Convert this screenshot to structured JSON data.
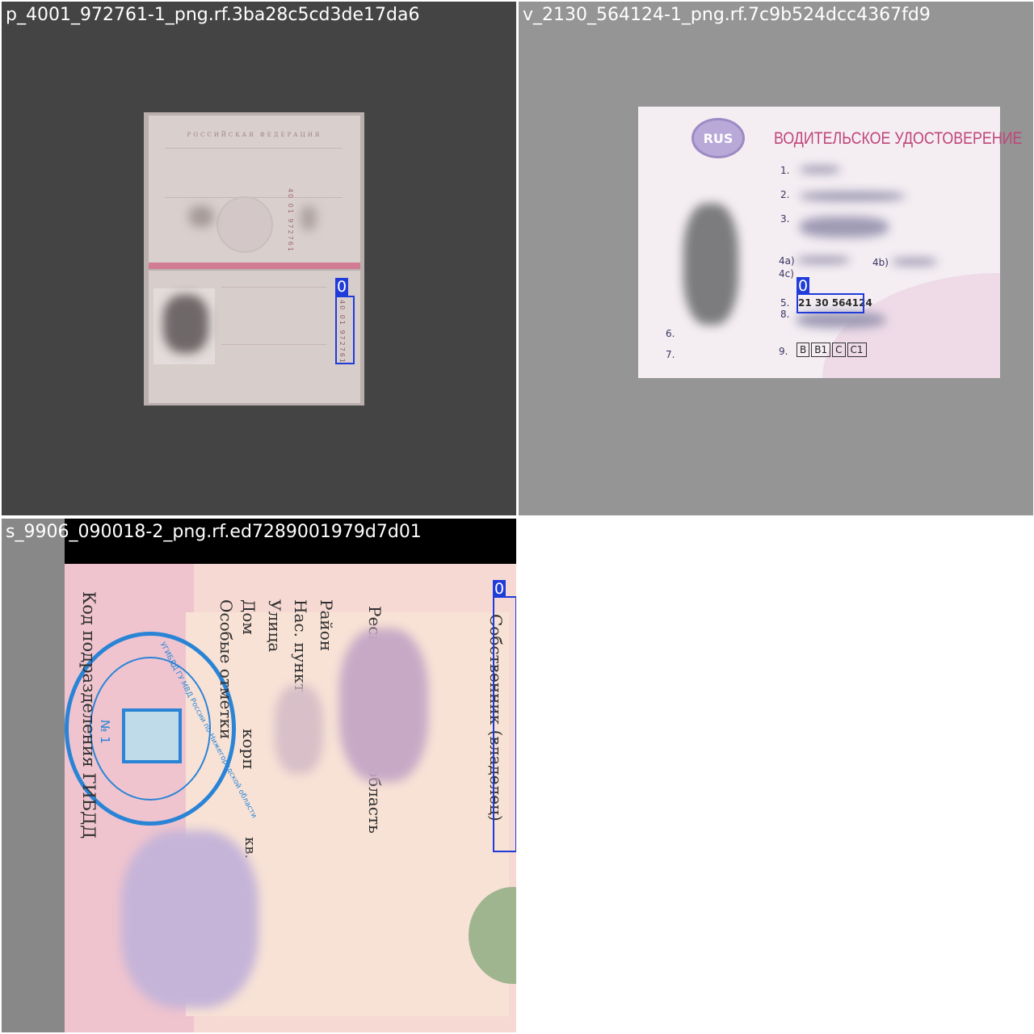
{
  "tiles": [
    {
      "title": "p_4001_972761-1_png.rf.3ba28c5cd3de17da6",
      "background": "#444444",
      "doc": {
        "country_header": "РОССИЙСКАЯ ФЕДЕРАЦИЯ",
        "series_top": "40 01 972761",
        "series_bottom": "40 01 972761"
      },
      "detections": [
        {
          "label": "0"
        }
      ]
    },
    {
      "title": "v_2130_564124-1_png.rf.7c9b524dcc4367fd9",
      "background": "#959595",
      "doc": {
        "emblem": "RUS",
        "header": "ВОДИТЕЛЬСКОЕ УДОСТОВЕРЕНИЕ",
        "fields": [
          "1.",
          "2.",
          "3.",
          "4a)",
          "4b)",
          "4c)",
          "5.",
          "8.",
          "6.",
          "7.",
          "9."
        ],
        "licence_number": "21 30 564124",
        "categories": [
          "B",
          "B1",
          "C",
          "C1"
        ]
      },
      "detections": [
        {
          "label": "0"
        }
      ]
    },
    {
      "title": "s_9906_090018-2_png.rf.ed7289001979d7d01",
      "background": "#888888",
      "doc": {
        "owner_label": "Собственник (владелец)",
        "region_label": "Республика, край, область",
        "district_label": "Район",
        "settlement_label": "Нас. пункт",
        "street_label": "Улица",
        "house_label": "Дом",
        "building_label": "корп",
        "apartment_label": "кв.",
        "notes_label": "Особые отметки",
        "department_label": "Код подразделения ГИБДД",
        "stamp_text": "УГИБДД ГУ МВД России по Нижегородской области",
        "stamp_number": "№ 1"
      },
      "detections": [
        {
          "label": "0"
        }
      ]
    }
  ],
  "colors": {
    "box": "#1f3bd9",
    "licence_header": "#c0457a",
    "stamp": "#2a84d6"
  }
}
